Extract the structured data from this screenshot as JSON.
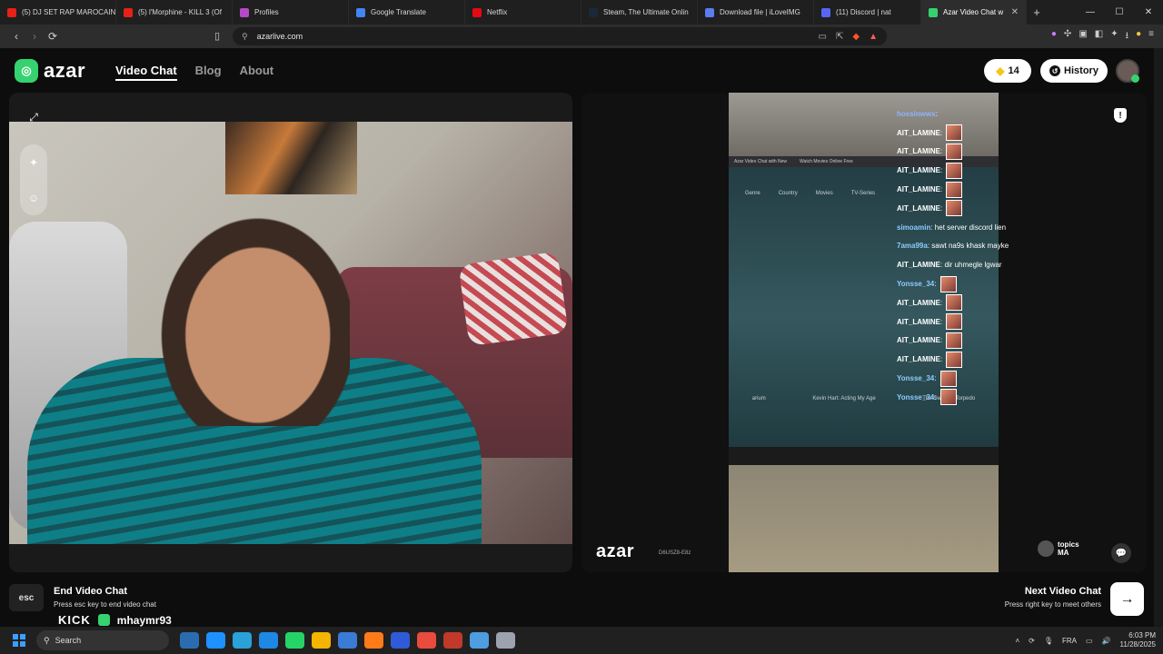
{
  "browser": {
    "tabs": [
      {
        "label": "(5) DJ SET RAP MAROCAIN",
        "color": "#e62117"
      },
      {
        "label": "(5) l'Morphine - KILL 3 (Of",
        "color": "#e62117"
      },
      {
        "label": "Profiles",
        "color": "#b548c6"
      },
      {
        "label": "Google Translate",
        "color": "#4285f4"
      },
      {
        "label": "Netflix",
        "color": "#e50914"
      },
      {
        "label": "Steam, The Ultimate Onlin",
        "color": "#1b2838"
      },
      {
        "label": "Download file | iLoveIMG",
        "color": "#5b7cf0"
      },
      {
        "label": "(11) Discord | nat",
        "color": "#5865f2"
      },
      {
        "label": "Azar Video Chat w",
        "color": "#35d36f",
        "active": true
      }
    ],
    "new_tab": "+",
    "url": "azarlive.com",
    "window_controls": [
      "—",
      "☐",
      "✕"
    ]
  },
  "header": {
    "logo_text": "azar",
    "nav": [
      {
        "label": "Video Chat",
        "active": true
      },
      {
        "label": "Blog"
      },
      {
        "label": "About"
      }
    ],
    "gems": "14",
    "history_label": "History"
  },
  "remote": {
    "logo_text": "azar",
    "code": "D6USZ8-E8z",
    "topics_label": "topics",
    "country": "MA",
    "screen": {
      "tabs": [
        "Azar Video Chat with New",
        "Watch Movies Online Free"
      ],
      "menu": [
        "Genre",
        "Country",
        "Movies",
        "TV-Series"
      ],
      "titles": [
        "arium",
        "Kevin Hart: Acting My Age",
        "The Swedish Torpedo"
      ]
    }
  },
  "chat": [
    {
      "user": "hossinwwx",
      "text": "",
      "color": "#8fb3ff"
    },
    {
      "user": "AIT_LAMINE",
      "text": "",
      "color": "#ffffff",
      "emote": true
    },
    {
      "user": "AIT_LAMINE",
      "text": "",
      "color": "#ffffff",
      "emote": true
    },
    {
      "user": "AIT_LAMINE",
      "text": "",
      "color": "#ffffff",
      "emote": true
    },
    {
      "user": "AIT_LAMINE",
      "text": "",
      "color": "#ffffff",
      "emote": true
    },
    {
      "user": "AIT_LAMINE",
      "text": "",
      "color": "#ffffff",
      "emote": true
    },
    {
      "user": "simoamin",
      "text": "het server discord lien",
      "color": "#8ecbff"
    },
    {
      "user": "7ama99a",
      "text": "sawt na9s khask mayke",
      "color": "#8ecbff"
    },
    {
      "user": "AIT_LAMINE",
      "text": "dir uhmegle lgwar",
      "color": "#ffffff"
    },
    {
      "user": "Yonsse_34",
      "text": "",
      "color": "#8ecbff",
      "emote": true
    },
    {
      "user": "AIT_LAMINE",
      "text": "",
      "color": "#ffffff",
      "emote": true
    },
    {
      "user": "AIT_LAMINE",
      "text": "",
      "color": "#ffffff",
      "emote": true
    },
    {
      "user": "AIT_LAMINE",
      "text": "",
      "color": "#ffffff",
      "emote": true
    },
    {
      "user": "AIT_LAMINE",
      "text": "",
      "color": "#ffffff",
      "emote": true
    },
    {
      "user": "Yonsse_34",
      "text": "",
      "color": "#8ecbff",
      "emote": true
    },
    {
      "user": "Yonsse_34",
      "text": "",
      "color": "#8ecbff",
      "emote": true
    }
  ],
  "footer": {
    "esc_key": "esc",
    "end_title": "End Video Chat",
    "end_sub": "Press esc key to end video chat",
    "next_title": "Next Video Chat",
    "next_sub": "Press right key to meet others",
    "kick_logo": "KICK",
    "kick_handle": "mhaymr93"
  },
  "taskbar": {
    "search_placeholder": "Search",
    "language": "FRA",
    "time": "6:03 PM",
    "date": "11/28/2025",
    "app_colors": [
      "#2b6cb0",
      "#1e90ff",
      "#2aa1d9",
      "#1e88e5",
      "#25d366",
      "#f4b400",
      "#3a7bd5",
      "#ff7a18",
      "#2f5bd8",
      "#e94b3c",
      "#c0392b",
      "#4d9de0",
      "#9ca3af"
    ]
  },
  "colors": {
    "brand": "#35d36f",
    "gem": "#f5c518"
  }
}
